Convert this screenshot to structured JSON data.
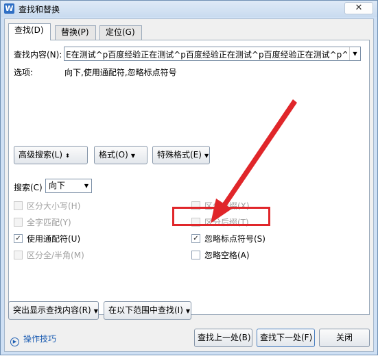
{
  "window": {
    "title": "查找和替换",
    "app_icon": "W",
    "close_label": "✕"
  },
  "tabs": [
    {
      "label": "查找(D)"
    },
    {
      "label": "替换(P)"
    },
    {
      "label": "定位(G)"
    }
  ],
  "find": {
    "label": "查找内容(N):",
    "value": "E在测试^p百度经验正在测试^p百度经验正在测试^p百度经验正在测试^p^p"
  },
  "options_summary": {
    "label": "选项:",
    "value": "向下,使用通配符,忽略标点符号"
  },
  "buttons": {
    "advanced_search": "高级搜索(L)",
    "format": "格式(O)",
    "special_format": "特殊格式(E)",
    "highlight_all": "突出显示查找内容(R)",
    "find_in": "在以下范围中查找(I)",
    "find_prev": "查找上一处(B)",
    "find_next": "查找下一处(F)",
    "close": "关闭"
  },
  "search_direction": {
    "label": "搜索(C)",
    "value": "向下"
  },
  "options_left": [
    {
      "label": "区分大小写(H)",
      "checked": false,
      "enabled": false
    },
    {
      "label": "全字匹配(Y)",
      "checked": false,
      "enabled": false
    },
    {
      "label": "使用通配符(U)",
      "checked": true,
      "enabled": true
    },
    {
      "label": "区分全/半角(M)",
      "checked": false,
      "enabled": false
    }
  ],
  "options_right": [
    {
      "label": "区分前缀(X)",
      "checked": false,
      "enabled": false
    },
    {
      "label": "区分后缀(T)",
      "checked": false,
      "enabled": false
    },
    {
      "label": "忽略标点符号(S)",
      "checked": true,
      "enabled": true
    },
    {
      "label": "忽略空格(A)",
      "checked": false,
      "enabled": true
    }
  ],
  "tips_link": "操作技巧",
  "colors": {
    "annotation_red": "#e0262a",
    "link_blue": "#1f5fb3"
  }
}
